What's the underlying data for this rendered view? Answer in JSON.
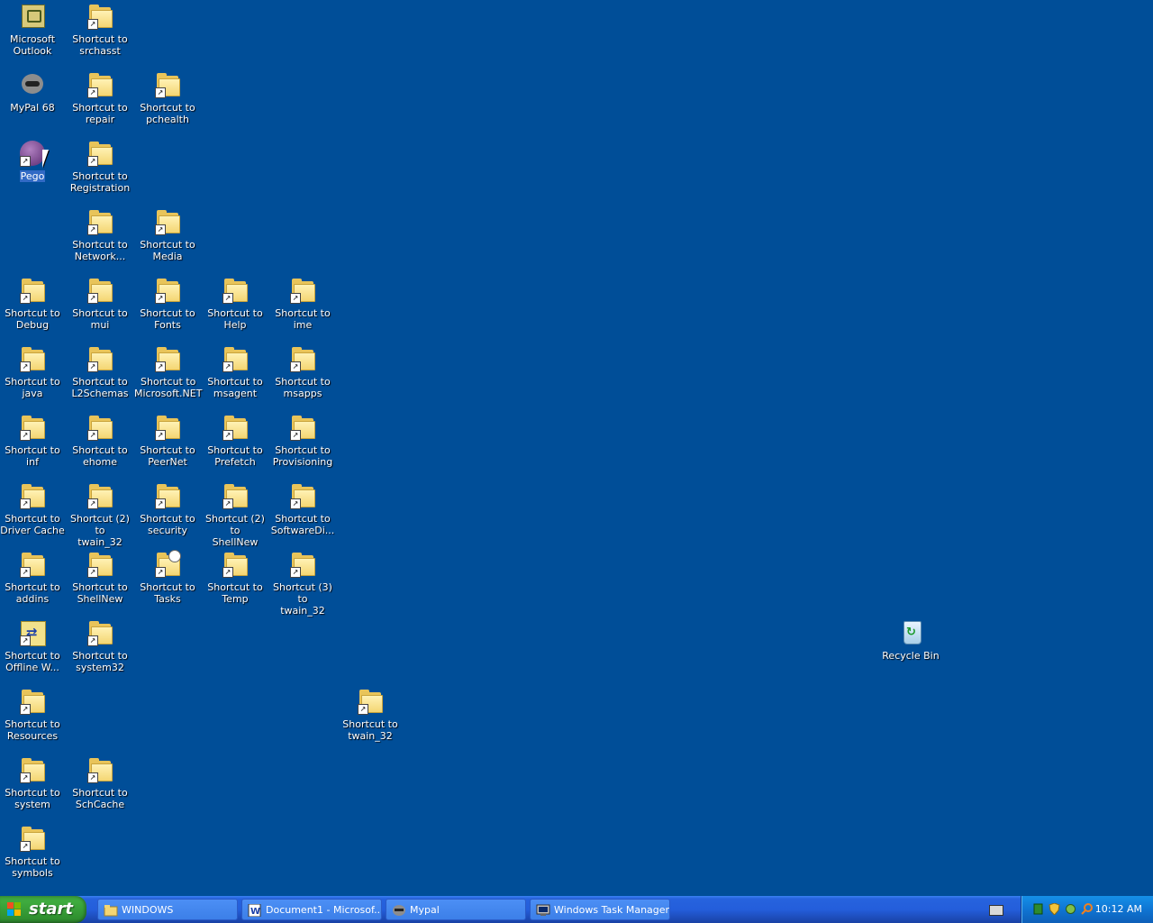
{
  "desktop": {
    "icons": [
      {
        "id": "outlook",
        "label_lines": [
          "Microsoft",
          "Outlook"
        ],
        "type": "outlook"
      },
      {
        "id": "srchasst",
        "label_lines": [
          "Shortcut to",
          "srchasst"
        ],
        "type": "folder"
      },
      {
        "id": "mypal",
        "label_lines": [
          "MyPal 68"
        ],
        "type": "raccoon"
      },
      {
        "id": "repair",
        "label_lines": [
          "Shortcut to",
          "repair"
        ],
        "type": "folder"
      },
      {
        "id": "pchealth",
        "label_lines": [
          "Shortcut to",
          "pchealth"
        ],
        "type": "folder"
      },
      {
        "id": "pego",
        "label_lines": [
          "Pego"
        ],
        "type": "pego",
        "selected": true
      },
      {
        "id": "registration",
        "label_lines": [
          "Shortcut to",
          "Registration"
        ],
        "type": "folder"
      },
      {
        "id": "network",
        "label_lines": [
          "Shortcut to",
          "Network..."
        ],
        "type": "folder"
      },
      {
        "id": "media",
        "label_lines": [
          "Shortcut to",
          "Media"
        ],
        "type": "folder"
      },
      {
        "id": "debug",
        "label_lines": [
          "Shortcut to",
          "Debug"
        ],
        "type": "folder"
      },
      {
        "id": "mui",
        "label_lines": [
          "Shortcut to",
          "mui"
        ],
        "type": "folder"
      },
      {
        "id": "fonts",
        "label_lines": [
          "Shortcut to",
          "Fonts"
        ],
        "type": "folder"
      },
      {
        "id": "help",
        "label_lines": [
          "Shortcut to",
          "Help"
        ],
        "type": "folder"
      },
      {
        "id": "ime",
        "label_lines": [
          "Shortcut to",
          "ime"
        ],
        "type": "folder"
      },
      {
        "id": "java",
        "label_lines": [
          "Shortcut to",
          "java"
        ],
        "type": "folder"
      },
      {
        "id": "l2schemas",
        "label_lines": [
          "Shortcut to",
          "L2Schemas"
        ],
        "type": "folder"
      },
      {
        "id": "dotnet",
        "label_lines": [
          "Shortcut to",
          "Microsoft.NET"
        ],
        "type": "folder"
      },
      {
        "id": "msagent",
        "label_lines": [
          "Shortcut to",
          "msagent"
        ],
        "type": "folder"
      },
      {
        "id": "msapps",
        "label_lines": [
          "Shortcut to",
          "msapps"
        ],
        "type": "folder"
      },
      {
        "id": "inf",
        "label_lines": [
          "Shortcut to inf"
        ],
        "type": "folder"
      },
      {
        "id": "ehome",
        "label_lines": [
          "Shortcut to",
          "ehome"
        ],
        "type": "folder"
      },
      {
        "id": "peernet",
        "label_lines": [
          "Shortcut to",
          "PeerNet"
        ],
        "type": "folder"
      },
      {
        "id": "prefetch",
        "label_lines": [
          "Shortcut to",
          "Prefetch"
        ],
        "type": "folder"
      },
      {
        "id": "provisioning",
        "label_lines": [
          "Shortcut to",
          "Provisioning"
        ],
        "type": "folder"
      },
      {
        "id": "drivercache",
        "label_lines": [
          "Shortcut to",
          "Driver Cache"
        ],
        "type": "folder"
      },
      {
        "id": "twain2",
        "label_lines": [
          "Shortcut (2) to",
          "twain_32"
        ],
        "type": "folder"
      },
      {
        "id": "security",
        "label_lines": [
          "Shortcut to",
          "security"
        ],
        "type": "folder"
      },
      {
        "id": "shellnew2",
        "label_lines": [
          "Shortcut (2) to",
          "ShellNew"
        ],
        "type": "folder"
      },
      {
        "id": "softwaredist",
        "label_lines": [
          "Shortcut to",
          "SoftwareDi..."
        ],
        "type": "folder"
      },
      {
        "id": "addins",
        "label_lines": [
          "Shortcut to",
          "addins"
        ],
        "type": "folder"
      },
      {
        "id": "shellnew",
        "label_lines": [
          "Shortcut to",
          "ShellNew"
        ],
        "type": "folder"
      },
      {
        "id": "tasks",
        "label_lines": [
          "Shortcut to",
          "Tasks"
        ],
        "type": "tasks"
      },
      {
        "id": "temp",
        "label_lines": [
          "Shortcut to",
          "Temp"
        ],
        "type": "folder"
      },
      {
        "id": "twain3",
        "label_lines": [
          "Shortcut (3) to",
          "twain_32"
        ],
        "type": "folder"
      },
      {
        "id": "offline",
        "label_lines": [
          "Shortcut to",
          "Offline W..."
        ],
        "type": "sync"
      },
      {
        "id": "system32",
        "label_lines": [
          "Shortcut to",
          "system32"
        ],
        "type": "folder"
      },
      {
        "id": "resources",
        "label_lines": [
          "Shortcut to",
          "Resources"
        ],
        "type": "folder"
      },
      {
        "id": "twain",
        "label_lines": [
          "Shortcut to",
          "twain_32"
        ],
        "type": "folder"
      },
      {
        "id": "system",
        "label_lines": [
          "Shortcut to",
          "system"
        ],
        "type": "folder"
      },
      {
        "id": "schcache",
        "label_lines": [
          "Shortcut to",
          "SchCache"
        ],
        "type": "folder"
      },
      {
        "id": "symbols",
        "label_lines": [
          "Shortcut to",
          "symbols"
        ],
        "type": "folder"
      },
      {
        "id": "recyclebin",
        "label_lines": [
          "Recycle Bin"
        ],
        "type": "bin"
      }
    ]
  },
  "taskbar": {
    "start_label": "start",
    "tasks": [
      {
        "label": "WINDOWS",
        "icon": "folder-icon"
      },
      {
        "label": "Document1 - Microsof...",
        "icon": "word-icon"
      },
      {
        "label": "Mypal",
        "icon": "raccoon-icon"
      },
      {
        "label": "Windows Task Manager",
        "icon": "task-manager-icon"
      }
    ],
    "tray": {
      "icons": [
        "network-status-icon",
        "security-shield-icon",
        "connection-icon",
        "search-icon"
      ],
      "clock": "10:12 AM"
    }
  },
  "colors": {
    "desktop_background": "#004e98",
    "taskbar": "#245edb",
    "start_button": "#3fac3f",
    "tray": "#0f75d3",
    "selection": "#316ac5"
  }
}
